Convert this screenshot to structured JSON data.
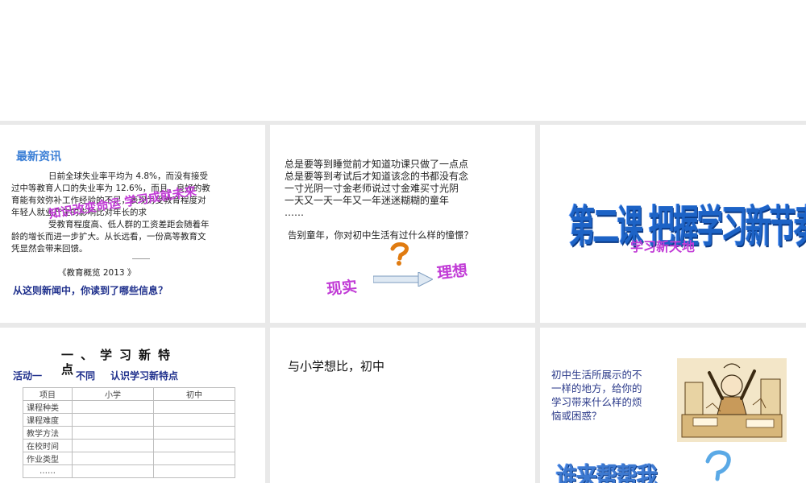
{
  "slide1": {
    "heading": "最新资讯",
    "para_l1": "日前全球失业率平均为 4.8%，而没有接受",
    "para_l2": "过中等教育人口的失业率为 12.6%，而且，良好的教",
    "para_l3": "育能有效弥补工作经验的不足，表现为受教育程度对",
    "para_l4": "年轻人就业产生的影响比对年长的求",
    "para_l5": "受教育程度高、低人群的工资差距会随着年",
    "para_l6": "龄的增长而进一步扩大。从长远看，一份高等教育文",
    "para_l7": "凭显然会带来回馈。",
    "source": "《教育概览 2013 》",
    "wordart": "知识改变命运  学习成就未来",
    "question": "从这则新闻中，你读到了哪些信息？"
  },
  "slide2": {
    "lines": [
      "总是要等到睡觉前才知道功课只做了一点点",
      "总是要等到考试后才知道该念的书都没有念",
      "一寸光阴一寸金老师说过寸金难买寸光阴",
      "一天又一天一年又一年迷迷糊糊的童年",
      "……"
    ],
    "question": "告别童年，你对初中生活有过什么样的憧憬？",
    "reality": "现实",
    "ideal": "理想"
  },
  "slide3": {
    "main_title": "第二课 把握学习新节奏",
    "sub_title": "学习新天地"
  },
  "slide4": {
    "heading": "一、学习新特点",
    "activity": "活动一",
    "activity_sub": "不同",
    "activity_desc": "认识学习新特点",
    "table_headers": [
      "项目",
      "小学",
      "初中"
    ],
    "table_rows": [
      "课程种类",
      "课程难度",
      "教学方法",
      "在校时间",
      "作业类型",
      "……"
    ]
  },
  "slide5": {
    "text": "与小学想比，初中"
  },
  "slide6": {
    "question": "初中生活所展示的不一样的地方，给你的学习带来什么样的烦恼或困惑？",
    "q_l1": "初中生活所展示的不",
    "q_l2": "一样的地方，给你的",
    "q_l3": "学习带来什么样的烦",
    "q_l4": "恼或困惑？",
    "wordart": "谁来帮帮我",
    "qmark": "?"
  },
  "colors": {
    "heading_blue": "#3b7fd6",
    "navy_text": "#1e2f8c",
    "wordart_purple": "#c13bd6",
    "title_blue": "#1d63c6",
    "gap_gray": "#e9e9e9"
  }
}
